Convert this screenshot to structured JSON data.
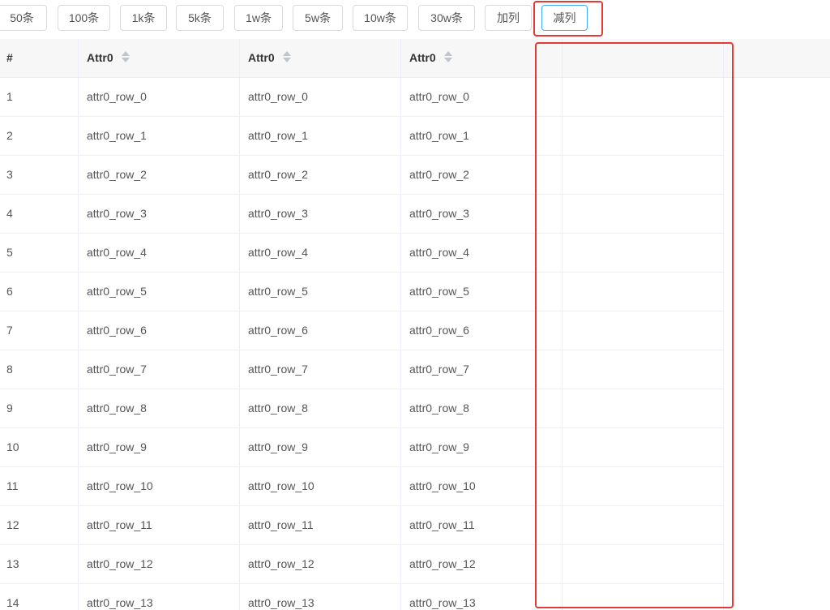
{
  "toolbar": {
    "buttons": [
      {
        "label": "50条"
      },
      {
        "label": "100条"
      },
      {
        "label": "1k条"
      },
      {
        "label": "5k条"
      },
      {
        "label": "1w条"
      },
      {
        "label": "5w条"
      },
      {
        "label": "10w条"
      },
      {
        "label": "30w条"
      },
      {
        "label": "加列"
      },
      {
        "label": "减列"
      }
    ]
  },
  "table": {
    "headers": [
      "#",
      "Attr0",
      "Attr0",
      "Attr0",
      ""
    ],
    "rows": [
      {
        "index": "1",
        "cells": [
          "attr0_row_0",
          "attr0_row_0",
          "attr0_row_0",
          ""
        ]
      },
      {
        "index": "2",
        "cells": [
          "attr0_row_1",
          "attr0_row_1",
          "attr0_row_1",
          ""
        ]
      },
      {
        "index": "3",
        "cells": [
          "attr0_row_2",
          "attr0_row_2",
          "attr0_row_2",
          ""
        ]
      },
      {
        "index": "4",
        "cells": [
          "attr0_row_3",
          "attr0_row_3",
          "attr0_row_3",
          ""
        ]
      },
      {
        "index": "5",
        "cells": [
          "attr0_row_4",
          "attr0_row_4",
          "attr0_row_4",
          ""
        ]
      },
      {
        "index": "6",
        "cells": [
          "attr0_row_5",
          "attr0_row_5",
          "attr0_row_5",
          ""
        ]
      },
      {
        "index": "7",
        "cells": [
          "attr0_row_6",
          "attr0_row_6",
          "attr0_row_6",
          ""
        ]
      },
      {
        "index": "8",
        "cells": [
          "attr0_row_7",
          "attr0_row_7",
          "attr0_row_7",
          ""
        ]
      },
      {
        "index": "9",
        "cells": [
          "attr0_row_8",
          "attr0_row_8",
          "attr0_row_8",
          ""
        ]
      },
      {
        "index": "10",
        "cells": [
          "attr0_row_9",
          "attr0_row_9",
          "attr0_row_9",
          ""
        ]
      },
      {
        "index": "11",
        "cells": [
          "attr0_row_10",
          "attr0_row_10",
          "attr0_row_10",
          ""
        ]
      },
      {
        "index": "12",
        "cells": [
          "attr0_row_11",
          "attr0_row_11",
          "attr0_row_11",
          ""
        ]
      },
      {
        "index": "13",
        "cells": [
          "attr0_row_12",
          "attr0_row_12",
          "attr0_row_12",
          ""
        ]
      },
      {
        "index": "14",
        "cells": [
          "attr0_row_13",
          "attr0_row_13",
          "attr0_row_13",
          ""
        ]
      }
    ]
  },
  "annotations": {
    "highlight_color": "#e53935"
  }
}
